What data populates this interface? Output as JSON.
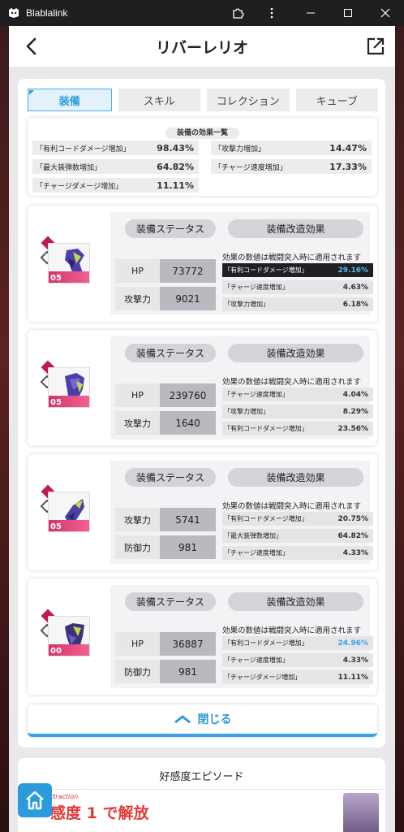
{
  "window": {
    "title": "Blablalink",
    "icons": [
      "app-icon",
      "extension-icon",
      "more-icon",
      "minimize-icon",
      "maximize-icon",
      "close-icon"
    ]
  },
  "header": {
    "title": "リバーレリオ",
    "icons": [
      "back-arrow-icon",
      "share-icon"
    ]
  },
  "tabs": [
    {
      "label": "装備",
      "active": true
    },
    {
      "label": "スキル",
      "active": false
    },
    {
      "label": "コレクション",
      "active": false
    },
    {
      "label": "キューブ",
      "active": false
    }
  ],
  "summary": {
    "title": "装備の効果一覧",
    "rows": [
      {
        "label": "「有利コードダメージ増加」",
        "value": "98.43%"
      },
      {
        "label": "「攻撃力増加」",
        "value": "14.47%"
      },
      {
        "label": "「最大装弾数増加」",
        "value": "64.82%"
      },
      {
        "label": "「チャージ速度増加」",
        "value": "17.33%"
      },
      {
        "label": "「チャージダメージ増加」",
        "value": "11.11%"
      }
    ]
  },
  "equipment": [
    {
      "level": "05",
      "status_label": "装備ステータス",
      "effects_label": "装備改造効果",
      "note": "効果の数値は戦闘突入時に適用されます",
      "stats": [
        {
          "label": "HP",
          "value": "73772"
        },
        {
          "label": "攻撃力",
          "value": "9021"
        }
      ],
      "effects": [
        {
          "label": "「有利コードダメージ増加」",
          "value": "29.16%",
          "highlight": true
        },
        {
          "label": "「チャージ速度増加」",
          "value": "4.63%"
        },
        {
          "label": "「攻撃力増加」",
          "value": "6.18%"
        }
      ]
    },
    {
      "level": "05",
      "status_label": "装備ステータス",
      "effects_label": "装備改造効果",
      "note": "効果の数値は戦闘突入時に適用されます",
      "stats": [
        {
          "label": "HP",
          "value": "239760"
        },
        {
          "label": "攻撃力",
          "value": "1640"
        }
      ],
      "effects": [
        {
          "label": "「チャージ速度増加」",
          "value": "4.04%"
        },
        {
          "label": "「攻撃力増加」",
          "value": "8.29%"
        },
        {
          "label": "「有利コードダメージ増加」",
          "value": "23.56%"
        }
      ]
    },
    {
      "level": "05",
      "status_label": "装備ステータス",
      "effects_label": "装備改造効果",
      "note": "効果の数値は戦闘突入時に適用されます",
      "stats": [
        {
          "label": "攻撃力",
          "value": "5741"
        },
        {
          "label": "防御力",
          "value": "981"
        }
      ],
      "effects": [
        {
          "label": "「有利コードダメージ増加」",
          "value": "20.75%"
        },
        {
          "label": "「最大装弾数増加」",
          "value": "64.82%"
        },
        {
          "label": "「チャージ速度増加」",
          "value": "4.33%"
        }
      ]
    },
    {
      "level": "00",
      "status_label": "装備ステータス",
      "effects_label": "装備改造効果",
      "note": "効果の数値は戦闘突入時に適用されます",
      "stats": [
        {
          "label": "HP",
          "value": "36887"
        },
        {
          "label": "防御力",
          "value": "981"
        }
      ],
      "effects": [
        {
          "label": "「有利コードダメージ増加」",
          "value": "24.96%",
          "blue": true
        },
        {
          "label": "「チャージ速度増加」",
          "value": "4.33%"
        },
        {
          "label": "「チャージダメージ増加」",
          "value": "11.11%"
        }
      ]
    }
  ],
  "close_button": {
    "label": "閉じる"
  },
  "episode": {
    "title": "好感度エピソード",
    "small": "ttraction",
    "unlock": "感度 1 で解放"
  },
  "colors": {
    "accent": "#2b9bdc",
    "highlight_row": "#1f1f24",
    "unlock": "#e53935"
  }
}
